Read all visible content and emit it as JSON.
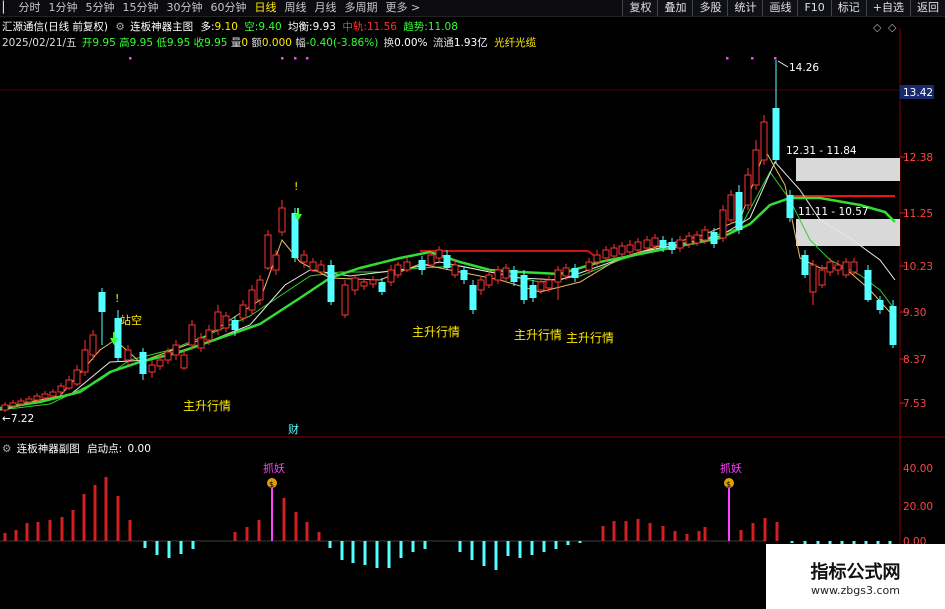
{
  "toolbar": {
    "periods": [
      {
        "label": "分时",
        "active": false
      },
      {
        "label": "1分钟",
        "active": false
      },
      {
        "label": "5分钟",
        "active": false
      },
      {
        "label": "15分钟",
        "active": false
      },
      {
        "label": "30分钟",
        "active": false
      },
      {
        "label": "60分钟",
        "active": false
      },
      {
        "label": "日线",
        "active": true
      },
      {
        "label": "周线",
        "active": false
      },
      {
        "label": "月线",
        "active": false
      },
      {
        "label": "多周期",
        "active": false
      },
      {
        "label": "更多 >",
        "active": false
      }
    ],
    "right_buttons": [
      "复权",
      "叠加",
      "多股",
      "统计",
      "画线",
      "F10",
      "标记",
      "+自选",
      "返回"
    ]
  },
  "info": {
    "stock": "汇源通信(日线 前复权)",
    "indicator": "连板神器主图",
    "duo_label": "多:",
    "duo_value": "9.10",
    "kong_label": "空:",
    "kong_value": "9.40",
    "jh_label": "均衡:",
    "jh_value": "9.93",
    "zg_label": "中轨:",
    "zg_value": "11.56",
    "qs_label": "趋势:",
    "qs_value": "11.08",
    "date": "2025/02/21/五",
    "open_label": "开",
    "open": "9.95",
    "high_label": "高",
    "high": "9.95",
    "low_label": "低",
    "low": "9.95",
    "close_label": "收",
    "close": "9.95",
    "vol_label": "量",
    "vol": "0",
    "amt_label": "额",
    "amt": "0.000",
    "chg_label": "幅",
    "chg": "-0.40(-3.86%)",
    "turn_label": "换",
    "turn": "0.00%",
    "float_label": "流通",
    "float": "1.93亿",
    "concept": "光纤光缆"
  },
  "price_axis": {
    "ticks": [
      "12.38",
      "11.25",
      "10.23",
      "9.30",
      "8.37",
      "7.53"
    ],
    "current": "13.42"
  },
  "chart_annotations": {
    "high": "14.26",
    "low": "7.22",
    "zone1": "12.31 - 11.84",
    "zone2": "11.11 - 10.57",
    "main_up": "主升行情",
    "zhankong": "站空",
    "cai": "财",
    "excl": "!",
    "diamond": "◇"
  },
  "sub_panel": {
    "title": "连板神器副图",
    "start_label": "启动点:",
    "start_value": "0.00",
    "zhuayao": "抓妖",
    "money": "$",
    "axis": [
      "40.00",
      "20.00",
      "0.00"
    ]
  },
  "watermark": {
    "title": "指标公式网",
    "url": "www.zbgs3.com"
  },
  "colors": {
    "up": "#ff3232",
    "down": "#54ffff",
    "ma_green": "#33dd33",
    "yellow": "#ffea00",
    "magenta": "#ff40ff",
    "zone": "#d9d9d9"
  }
}
